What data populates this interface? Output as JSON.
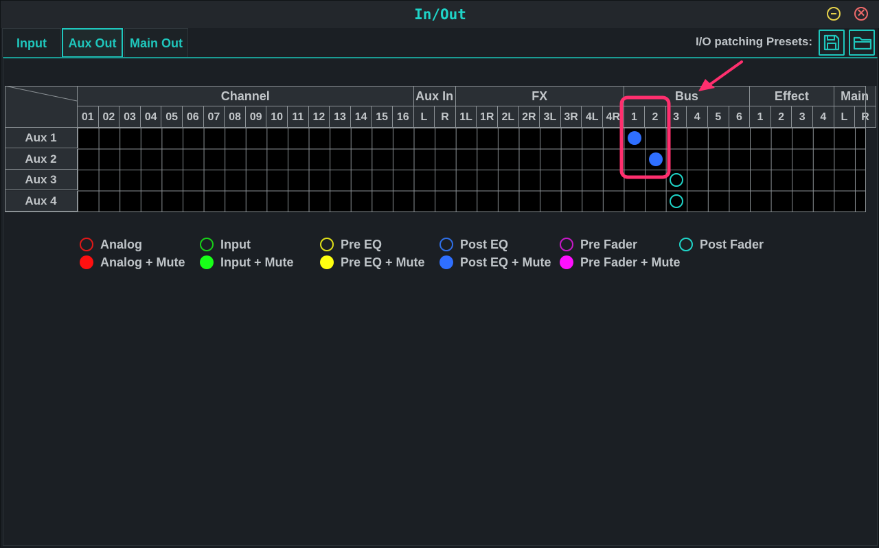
{
  "window": {
    "title": "In/Out"
  },
  "tabs": [
    {
      "label": "Input",
      "active": false
    },
    {
      "label": "Aux Out",
      "active": true
    },
    {
      "label": "Main Out",
      "active": false
    }
  ],
  "presets": {
    "label": "I/O patching Presets:",
    "save_icon": "save-icon",
    "open_icon": "folder-icon"
  },
  "grid": {
    "groups": [
      {
        "name": "Channel",
        "columns": [
          "01",
          "02",
          "03",
          "04",
          "05",
          "06",
          "07",
          "08",
          "09",
          "10",
          "11",
          "12",
          "13",
          "14",
          "15",
          "16"
        ]
      },
      {
        "name": "Aux In",
        "columns": [
          "L",
          "R"
        ]
      },
      {
        "name": "FX",
        "columns": [
          "1L",
          "1R",
          "2L",
          "2R",
          "3L",
          "3R",
          "4L",
          "4R"
        ]
      },
      {
        "name": "Bus",
        "columns": [
          "1",
          "2",
          "3",
          "4",
          "5",
          "6"
        ]
      },
      {
        "name": "Effect",
        "columns": [
          "1",
          "2",
          "3",
          "4"
        ]
      },
      {
        "name": "Main",
        "columns": [
          "L",
          "R"
        ]
      }
    ],
    "rows": [
      "Aux 1",
      "Aux 2",
      "Aux 3",
      "Aux 4"
    ],
    "assignments": [
      {
        "row": 0,
        "col": 26,
        "type": "post-eq-mute"
      },
      {
        "row": 1,
        "col": 27,
        "type": "post-eq-mute"
      },
      {
        "row": 2,
        "col": 28,
        "type": "post-fader"
      },
      {
        "row": 3,
        "col": 28,
        "type": "post-fader"
      }
    ]
  },
  "legend": [
    {
      "label": "Analog",
      "color": "#e01818",
      "filled": false
    },
    {
      "label": "Input",
      "color": "#18d018",
      "filled": false
    },
    {
      "label": "Pre EQ",
      "color": "#e0e018",
      "filled": false
    },
    {
      "label": "Post EQ",
      "color": "#2f6fe8",
      "filled": false
    },
    {
      "label": "Pre Fader",
      "color": "#c818c8",
      "filled": false
    },
    {
      "label": "Post Fader",
      "color": "#1fd4c8",
      "filled": false
    },
    {
      "label": "Analog + Mute",
      "color": "#ff1010",
      "filled": true
    },
    {
      "label": "Input + Mute",
      "color": "#18ff18",
      "filled": true
    },
    {
      "label": "Pre EQ + Mute",
      "color": "#ffff10",
      "filled": true
    },
    {
      "label": "Post EQ + Mute",
      "color": "#2f6fff",
      "filled": true
    },
    {
      "label": "Pre Fader + Mute",
      "color": "#ff10ff",
      "filled": true
    }
  ],
  "colors": {
    "accent": "#1fc7bd",
    "annotation": "#ff2f6e",
    "post_eq_mute": "#2f6fff",
    "post_fader": "#1fd4c8"
  }
}
